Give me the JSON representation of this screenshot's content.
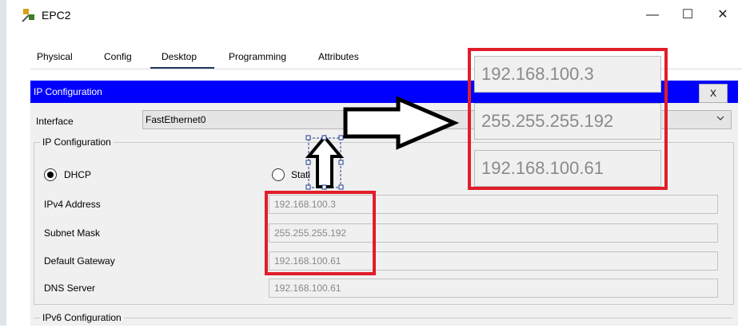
{
  "window": {
    "title": "EPC2",
    "minimize_glyph": "—",
    "maximize_glyph": "☐",
    "close_glyph": "✕"
  },
  "tabs": [
    {
      "label": "Physical"
    },
    {
      "label": "Config"
    },
    {
      "label": "Desktop"
    },
    {
      "label": "Programming"
    },
    {
      "label": "Attributes"
    }
  ],
  "active_tab": "Desktop",
  "ip_config": {
    "header": "IP Configuration",
    "close_label": "X",
    "interface_label": "Interface",
    "interface_value": "FastEthernet0",
    "group_title": "IP Configuration",
    "dhcp_label": "DHCP",
    "static_label": "Stati",
    "mode": "DHCP",
    "fields": [
      {
        "label": "IPv4 Address",
        "value": "192.168.100.3"
      },
      {
        "label": "Subnet Mask",
        "value": "255.255.255.192"
      },
      {
        "label": "Default Gateway",
        "value": "192.168.100.61"
      },
      {
        "label": "DNS Server",
        "value": "192.168.100.61"
      }
    ],
    "ipv6_group_title": "IPv6 Configuration"
  },
  "zoomed_values": [
    "192.168.100.3",
    "255.255.255.192",
    "192.168.100.61"
  ],
  "colors": {
    "highlight_red": "#e21d2a",
    "header_blue": "#0000ff"
  }
}
